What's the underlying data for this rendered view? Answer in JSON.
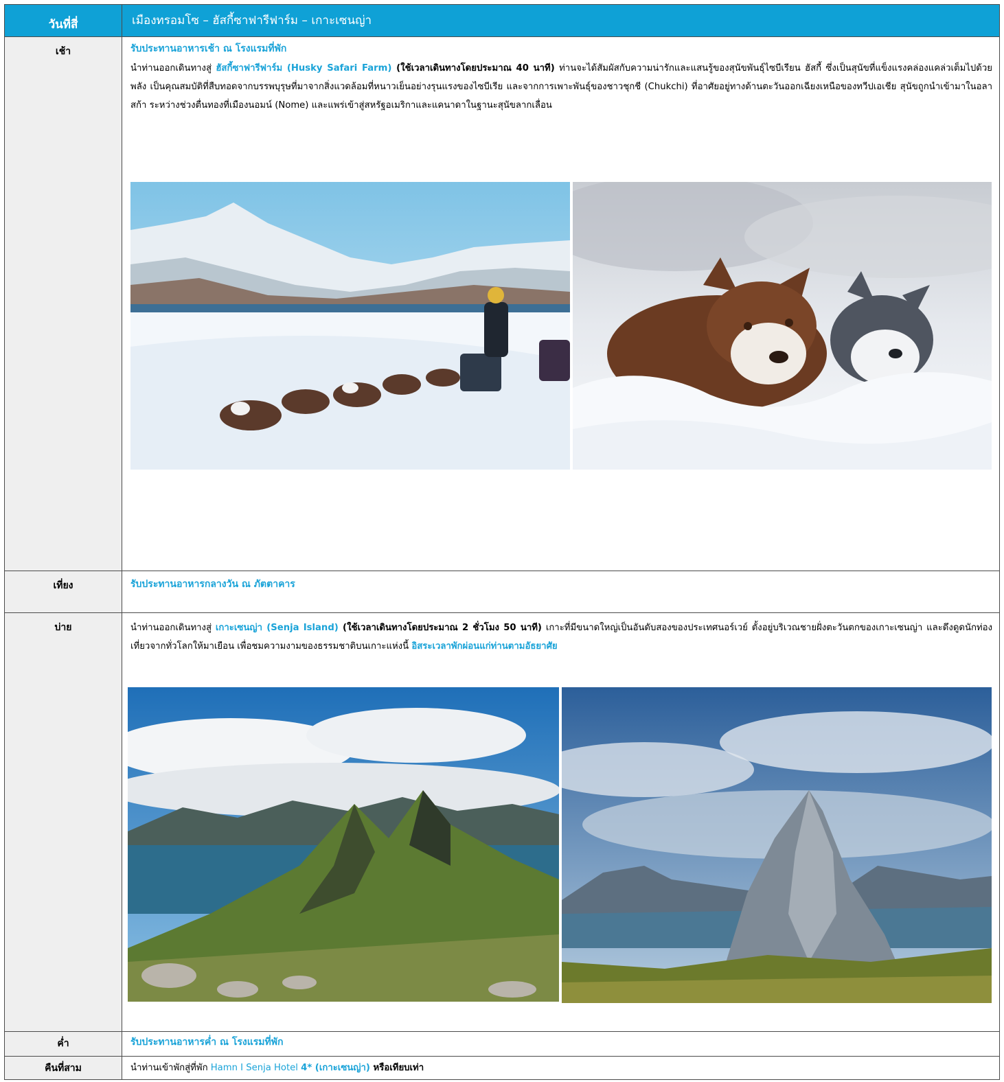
{
  "header": {
    "day": "วันที่สี่",
    "route": "เมืองทรอมโซ – ฮัสกี้ซาฟารีฟาร์ม – เกาะเซนญ่า"
  },
  "morning": {
    "label": "เช้า",
    "meal": "รับประทานอาหารเช้า ณ โรงแรมที่พัก",
    "intro": "นำท่านออกเดินทางสู่ ",
    "place": "ฮัสกี้ซาฟารีฟาร์ม (Husky Safari Farm)",
    "travel": " (ใช้เวลาเดินทางโดยประมาณ 40 นาที)",
    "body": " ท่านจะได้สัมผัสกับความน่ารักและแสนรู้ของสุนัขพันธุ์ไซบีเรียน ฮัสกี้ ซึ่งเป็นสุนัขที่แข็งแรงคล่องแคล่วเต็มไปด้วยพลัง เป็นคุณสมบัติที่สืบทอดจากบรรพบุรุษที่มาจากสิ่งแวดล้อมที่หนาวเย็นอย่างรุนแรงของไซบีเรีย และจากการเพาะพันธุ์ของชาวชุกชี (Chukchi) ที่อาศัยอยู่ทางด้านตะวันออกเฉียงเหนือของทวีปเอเชีย สุนัขถูกนำเข้ามาในอลาสก้า ระหว่างช่วงตื่นทองที่เมืองนอมน์ (Nome) และแพร่เข้าสู่สหรัฐอเมริกาและแคนาดาในฐานะสุนัขลากเลื่อน",
    "images": [
      "husky-sled-photo",
      "husky-dogs-snow-photo"
    ]
  },
  "lunch": {
    "label": "เที่ยง",
    "meal": "รับประทานอาหารกลางวัน ณ ภัตตาคาร"
  },
  "afternoon": {
    "label": "บ่าย",
    "intro": "นำท่านออกเดินทางสู่ ",
    "place": "เกาะเซนญ่า (Senja Island)",
    "travel": " (ใช้เวลาเดินทางโดยประมาณ 2 ชั่วโมง 50 นาที)",
    "body": " เกาะที่มีขนาดใหญ่เป็นอันดับสองของประเทศนอร์เวย์ ตั้งอยู่บริเวณชายฝั่งตะวันตกของเกาะเซนญ่า และดึงดูดนักท่องเที่ยวจากทั่วโลกให้มาเยือน เพื่อชมความงามของธรรมชาติบนเกาะแห่งนี้ ",
    "free": "อิสระเวลาพักผ่อนแก่ท่านตามอัธยาศัย",
    "images": [
      "senja-ridge-photo",
      "segla-peak-photo"
    ]
  },
  "dinner": {
    "label": "ค่ำ",
    "meal": "รับประทานอาหารค่ำ ณ โรงแรมที่พัก"
  },
  "night": {
    "label": "คืนที่สาม",
    "intro": "นำท่านเข้าพักสู่ที่พัก ",
    "hotel": "Hamn I Senja Hotel ",
    "stars": "4* (เกาะเซนญ่า)",
    "suffix": " หรือเทียบเท่า"
  },
  "colors": {
    "header_bg": "#0fa1d6",
    "accent": "#1aa3d8",
    "label_bg": "#efefef",
    "border": "#4a4a4a"
  }
}
